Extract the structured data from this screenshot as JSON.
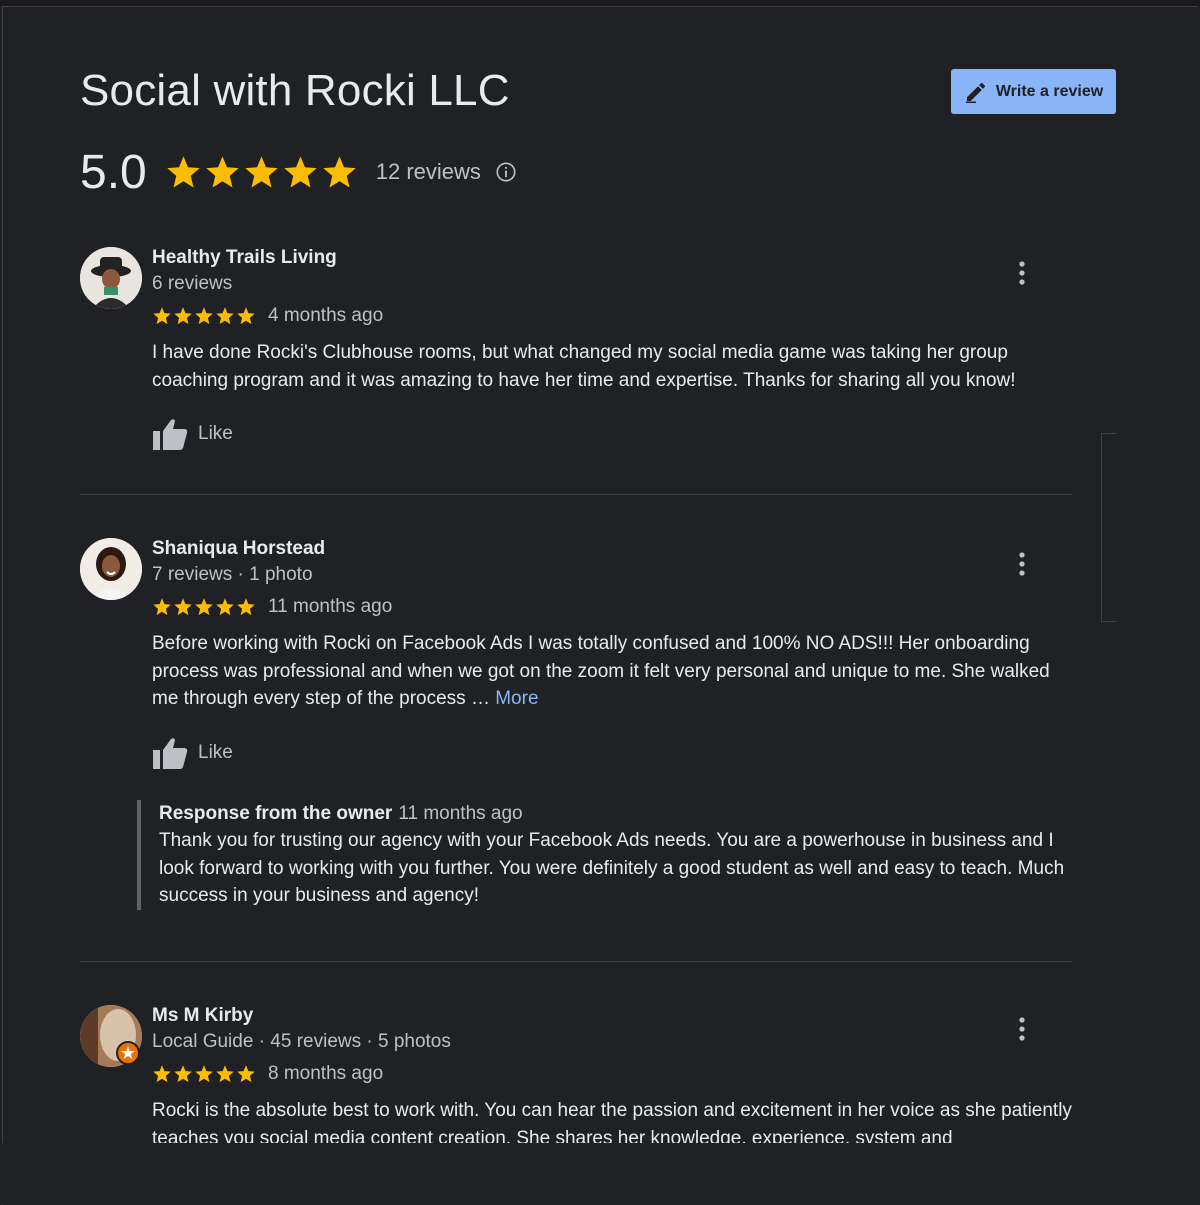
{
  "business": {
    "name": "Social with Rocki LLC",
    "rating": "5.0",
    "stars": 5,
    "review_count": "12 reviews"
  },
  "write_review_label": "Write a review",
  "colors": {
    "star": "#fbbc04",
    "accent": "#8ab4f8",
    "background": "#202124"
  },
  "reviews": [
    {
      "name": "Healthy Trails Living",
      "meta": "6 reviews",
      "stars": 5,
      "time": "4 months ago",
      "text": "I have done Rocki's Clubhouse rooms, but what changed my social media game was taking her group coaching program and it was amazing to have her time and expertise. Thanks for sharing all you know!",
      "like_label": "Like"
    },
    {
      "name": "Shaniqua Horstead",
      "meta": "7 reviews · 1 photo",
      "stars": 5,
      "time": "11 months ago",
      "text": "Before working with Rocki on Facebook Ads I was totally confused and 100% NO ADS!!! Her onboarding process was professional and when we got on the zoom it felt very personal and unique to me. She walked me through every step of the process …",
      "more_label": "More",
      "like_label": "Like",
      "owner_response": {
        "label": "Response from the owner",
        "time": "11 months ago",
        "text": "Thank you for trusting our agency with your Facebook Ads needs. You are a powerhouse in business and I look forward to working with you further. You were definitely a good student as well and easy to teach. Much success in your business and agency!"
      }
    },
    {
      "name": "Ms M Kirby",
      "meta": "Local Guide · 45 reviews · 5 photos",
      "stars": 5,
      "time": "8 months ago",
      "text": "Rocki is the absolute best to work with. You can hear the passion and excitement in her voice as she patiently teaches you social media content creation. She shares her knowledge, experience, system and"
    }
  ],
  "icons": {
    "write": "pencil-icon",
    "info": "info-icon",
    "like": "thumbs-up-icon",
    "menu": "more-vert-icon",
    "star": "star-icon",
    "local_guide": "local-guide-badge-icon"
  }
}
